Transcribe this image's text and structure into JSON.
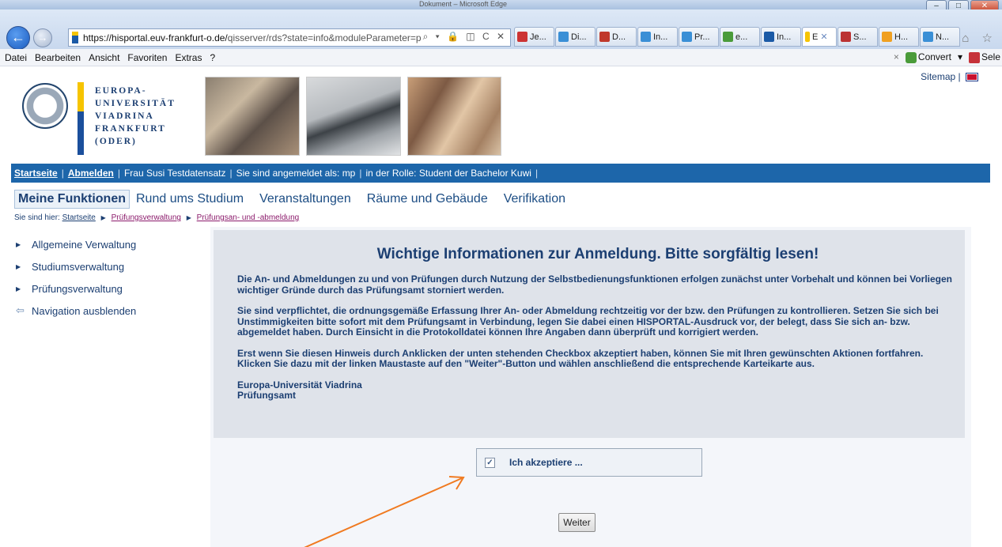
{
  "window": {
    "title": "Dokument – Microsoft Edge",
    "buttons": [
      "–",
      "□",
      "✕"
    ]
  },
  "browser": {
    "address_dark": "https://hisportal.euv-frankfurt-o.de/",
    "address_light": "qisserver/rds?state=info&moduleParameter=p",
    "address_icons": "⌕ ▾ 🔒 ◫ C ✕",
    "tabs": [
      {
        "label": "Je...",
        "color": "#c33"
      },
      {
        "label": "Di...",
        "color": "#3a8fd6"
      },
      {
        "label": "D...",
        "color": "#c0392b"
      },
      {
        "label": "In...",
        "color": "#3a8fd6"
      },
      {
        "label": "Pr...",
        "color": "#3a8fd6"
      },
      {
        "label": "e...",
        "color": "#4a9b3a"
      },
      {
        "label": "In...",
        "color": "#1b5aa6"
      },
      {
        "label": "E",
        "color": "#f6c400"
      },
      {
        "label": "S...",
        "color": "#b33"
      },
      {
        "label": "H...",
        "color": "#f0a020"
      },
      {
        "label": "N...",
        "color": "#3a8fd6"
      }
    ],
    "right_icons": "⌂ ☆"
  },
  "menu": {
    "items": [
      "Datei",
      "Bearbeiten",
      "Ansicht",
      "Favoriten",
      "Extras",
      "?"
    ],
    "close": "×",
    "convert": "Convert",
    "convert_arrow": "▾",
    "select": "Sele"
  },
  "header": {
    "logo_lines": [
      "EUROPA-",
      "UNIVERSITÄT",
      "VIADRINA",
      "FRANKFURT",
      "(ODER)"
    ],
    "sitemap": "Sitemap"
  },
  "userbar": {
    "startseite": "Startseite",
    "abmelden": "Abmelden",
    "user": "Frau Susi Testdatensatz",
    "login": "Sie sind angemeldet als: mp",
    "role": "in der Rolle: Student der Bachelor Kuwi"
  },
  "subnav": {
    "items": [
      "Meine Funktionen",
      "Rund ums Studium",
      "Veranstaltungen",
      "Räume und Gebäude",
      "Verifikation"
    ]
  },
  "breadcrumb": {
    "prefix": "Sie sind hier:",
    "items": [
      "Startseite",
      "Prüfungsverwaltung",
      "Prüfungsan- und -abmeldung"
    ]
  },
  "sidebar": {
    "items": [
      "Allgemeine Verwaltung",
      "Studiumsverwaltung",
      "Prüfungsverwaltung",
      "Navigation ausblenden"
    ]
  },
  "info": {
    "title": "Wichtige Informationen zur Anmeldung. Bitte sorgfältig lesen!",
    "p1": "Die An- und Abmeldungen zu und von Prüfungen durch Nutzung der Selbstbedienungsfunktionen erfolgen zunächst unter Vorbehalt und können bei Vorliegen wichtiger Gründe durch das Prüfungsamt storniert werden.",
    "p2": "Sie sind verpflichtet, die ordnungsgemäße Erfassung Ihrer An- oder Abmeldung rechtzeitig vor der bzw. den Prüfungen zu kontrollieren. Setzen Sie sich bei Unstimmigkeiten bitte sofort mit dem Prüfungsamt in Verbindung, legen Sie dabei einen HISPORTAL-Ausdruck vor, der belegt, dass Sie sich an- bzw. abgemeldet haben. Durch Einsicht in die Protokolldatei können Ihre Angaben dann überprüft und korrigiert werden.",
    "p3": "Erst wenn Sie diesen Hinweis durch Anklicken der unten stehenden Checkbox akzeptiert haben, können Sie mit Ihren gewünschten Aktionen fortfahren. Klicken Sie dazu mit der linken Maustaste auf den \"Weiter\"-Button und wählen anschließend die entsprechende Karteikarte aus.",
    "sig1": "Europa-Universität Viadrina",
    "sig2": "Prüfungsamt"
  },
  "form": {
    "checkbox_label": "Ich akzeptiere ...",
    "checkbox_mark": "✓",
    "checked": true,
    "weiter": "Weiter"
  },
  "colors": {
    "accent_blue": "#1d66aa",
    "arrow_orange": "#f07a20",
    "text_dark_blue": "#1c3f72"
  }
}
